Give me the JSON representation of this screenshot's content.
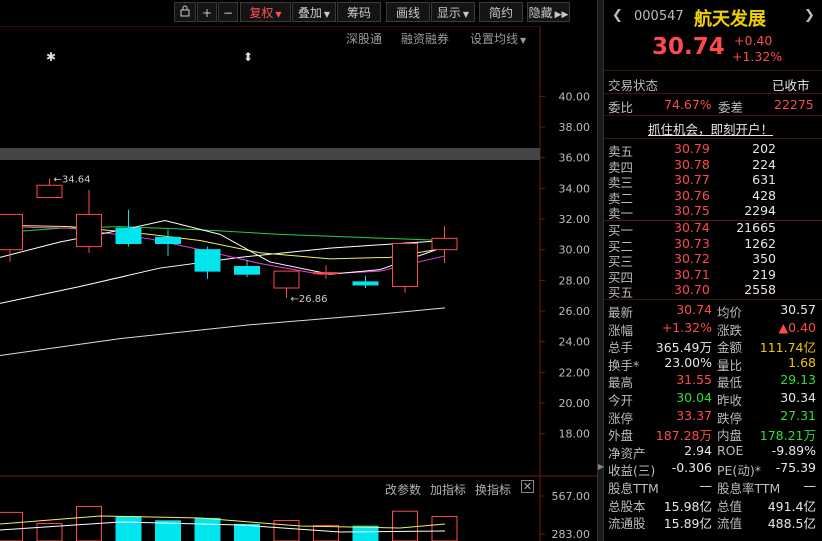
{
  "toolbar": {
    "buttons": [
      {
        "label": "",
        "icon": "lock-icon"
      },
      {
        "label": "+"
      },
      {
        "label": "−"
      },
      {
        "label": "复权",
        "active": true,
        "dropdown": true
      },
      {
        "label": "叠加",
        "dropdown": true
      },
      {
        "label": "筹码"
      },
      {
        "label": "画线"
      },
      {
        "label": "显示",
        "dropdown": true
      },
      {
        "label": "简约"
      },
      {
        "label": "隐藏"
      }
    ]
  },
  "chart_links": {
    "a": "深股通",
    "b": "融资融券",
    "c": "设置均线"
  },
  "chart_data": {
    "type": "candlestick",
    "y_ticks": [
      "40.00",
      "38.00",
      "36.00",
      "34.00",
      "32.00",
      "30.00",
      "28.00",
      "26.00",
      "24.00",
      "22.00",
      "20.00",
      "18.00"
    ],
    "ylim": [
      17,
      41
    ],
    "candles": [
      {
        "open": 30.0,
        "close": 32.3,
        "high": 32.3,
        "low": 29.2
      },
      {
        "open": 33.4,
        "close": 34.2,
        "high": 34.64,
        "low": 33.4
      },
      {
        "open": 30.2,
        "close": 32.3,
        "high": 33.9,
        "low": 29.8
      },
      {
        "open": 31.4,
        "close": 30.4,
        "high": 32.6,
        "low": 30.2
      },
      {
        "open": 30.8,
        "close": 30.4,
        "high": 31.3,
        "low": 29.6
      },
      {
        "open": 30.0,
        "close": 28.6,
        "high": 30.2,
        "low": 28.1
      },
      {
        "open": 28.9,
        "close": 28.4,
        "high": 29.3,
        "low": 28.2
      },
      {
        "open": 27.5,
        "close": 28.6,
        "high": 28.6,
        "low": 26.86
      },
      {
        "open": 28.5,
        "close": 28.5,
        "high": 29.0,
        "low": 28.1
      },
      {
        "open": 27.9,
        "close": 27.7,
        "high": 28.3,
        "low": 27.5
      },
      {
        "open": 27.6,
        "close": 30.4,
        "high": 30.5,
        "low": 27.2
      },
      {
        "open": 30.0,
        "close": 30.74,
        "high": 31.55,
        "low": 29.13
      }
    ],
    "annotations": {
      "high_label": "34.64",
      "low_label": "26.86"
    },
    "indicator_ticks": [
      "567.00",
      "283.00"
    ],
    "indicator_links": [
      "改参数",
      "加指标",
      "换指标"
    ]
  },
  "stock": {
    "code": "000547",
    "name": "航天发展",
    "price": "30.74",
    "change": "+0.40",
    "change_pct": "+1.32%",
    "status_label": "交易状态",
    "status_value": "已收市",
    "weibi_label": "委比",
    "weibi_value": "74.67%",
    "weicha_label": "委差",
    "weicha_value": "22275",
    "promo": "抓住机会，即刻开户！"
  },
  "order_book": {
    "asks": [
      {
        "label": "卖五",
        "price": "30.79",
        "vol": "202"
      },
      {
        "label": "卖四",
        "price": "30.78",
        "vol": "224"
      },
      {
        "label": "卖三",
        "price": "30.77",
        "vol": "631"
      },
      {
        "label": "卖二",
        "price": "30.76",
        "vol": "428"
      },
      {
        "label": "卖一",
        "price": "30.75",
        "vol": "2294"
      }
    ],
    "bids": [
      {
        "label": "买一",
        "price": "30.74",
        "vol": "21665"
      },
      {
        "label": "买二",
        "price": "30.73",
        "vol": "1262"
      },
      {
        "label": "买三",
        "price": "30.72",
        "vol": "350"
      },
      {
        "label": "买四",
        "price": "30.71",
        "vol": "219"
      },
      {
        "label": "买五",
        "price": "30.70",
        "vol": "2558"
      }
    ]
  },
  "quote": [
    {
      "l1": "最新",
      "v1": "30.74",
      "c1": "red",
      "l2": "均价",
      "v2": "30.57",
      "c2": "white"
    },
    {
      "l1": "涨幅",
      "v1": "+1.32%",
      "c1": "red",
      "l2": "涨跌",
      "v2": "▲0.40",
      "c2": "red"
    },
    {
      "l1": "总手",
      "v1": "365.49万",
      "c1": "white",
      "l2": "金额",
      "v2": "111.74亿",
      "c2": "yellow"
    },
    {
      "l1": "换手*",
      "v1": "23.00%",
      "c1": "white",
      "l2": "量比",
      "v2": "1.68",
      "c2": "yellow"
    },
    {
      "l1": "最高",
      "v1": "31.55",
      "c1": "red",
      "l2": "最低",
      "v2": "29.13",
      "c2": "green"
    },
    {
      "l1": "今开",
      "v1": "30.04",
      "c1": "green",
      "l2": "昨收",
      "v2": "30.34",
      "c2": "white"
    },
    {
      "l1": "涨停",
      "v1": "33.37",
      "c1": "red",
      "l2": "跌停",
      "v2": "27.31",
      "c2": "green"
    },
    {
      "l1": "外盘",
      "v1": "187.28万",
      "c1": "red",
      "l2": "内盘",
      "v2": "178.21万",
      "c2": "green"
    },
    {
      "l1": "净资产",
      "v1": "2.94",
      "c1": "white",
      "l2": "ROE",
      "v2": "-9.89%",
      "c2": "white"
    },
    {
      "l1": "收益(三)",
      "v1": "-0.306",
      "c1": "white",
      "l2": "PE(动)*",
      "v2": "-75.39",
      "c2": "white"
    },
    {
      "l1": "股息TTM",
      "v1": "—",
      "c1": "white",
      "l2": "股息率TTM",
      "v2": "—",
      "c2": "white"
    },
    {
      "l1": "总股本",
      "v1": "15.98亿",
      "c1": "white",
      "l2": "总值",
      "v2": "491.4亿",
      "c2": "white"
    },
    {
      "l1": "流通股",
      "v1": "15.89亿",
      "c1": "white",
      "l2": "流值",
      "v2": "488.5亿",
      "c2": "white"
    }
  ],
  "colors": {
    "up": "#ff4a4a",
    "down": "#00e5ee",
    "ma5": "#ffffff",
    "ma10": "#f0f060",
    "ma20": "#e040e0",
    "ma60": "#20d040"
  }
}
